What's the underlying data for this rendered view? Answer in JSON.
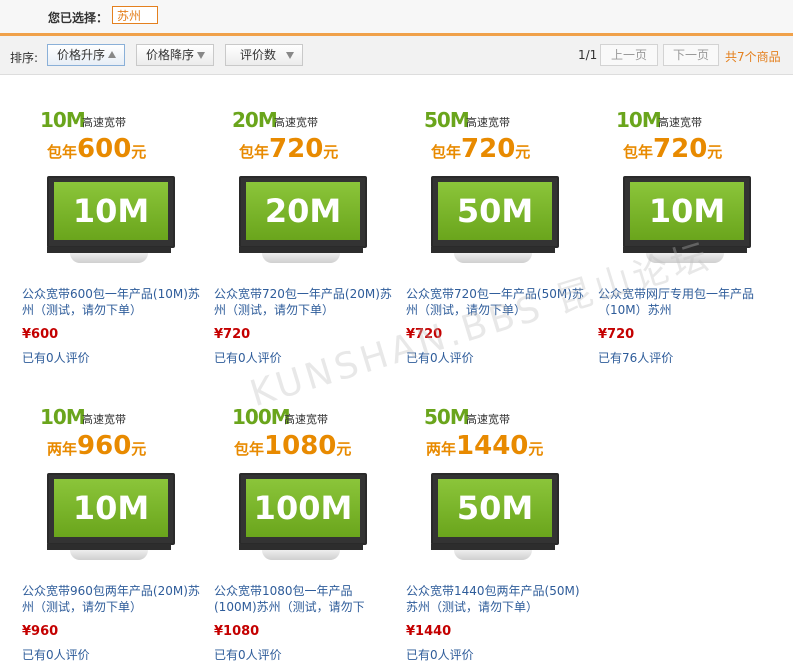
{
  "selected": {
    "label": "您已选择：",
    "value": "苏州"
  },
  "sort": {
    "label": "排序:",
    "buttons": [
      "价格升序",
      "价格降序",
      "评价数"
    ]
  },
  "pager": {
    "page": "1/1",
    "prev": "上一页",
    "next": "下一页",
    "total": "共7个商品"
  },
  "watermark": "KUNSHAN.BBS 昆山论坛",
  "products": [
    {
      "speed": "10M",
      "tag": "高速宽带",
      "price_prefix": "包年",
      "price_num": "600",
      "price_suffix": "元",
      "screen": "10M",
      "title": "公众宽带600包一年产品(10M)苏州（测试，请勿下单）",
      "price": "¥600",
      "reviews": "已有0人评价"
    },
    {
      "speed": "20M",
      "tag": "高速宽带",
      "price_prefix": "包年",
      "price_num": "720",
      "price_suffix": "元",
      "screen": "20M",
      "title": "公众宽带720包一年产品(20M)苏州（测试，请勿下单）",
      "price": "¥720",
      "reviews": "已有0人评价"
    },
    {
      "speed": "50M",
      "tag": "高速宽带",
      "price_prefix": "包年",
      "price_num": "720",
      "price_suffix": "元",
      "screen": "50M",
      "title": "公众宽带720包一年产品(50M)苏州（测试，请勿下单）",
      "price": "¥720",
      "reviews": "已有0人评价"
    },
    {
      "speed": "10M",
      "tag": "高速宽带",
      "price_prefix": "包年",
      "price_num": "720",
      "price_suffix": "元",
      "screen": "10M",
      "title": "公众宽带网厅专用包一年产品（10M）苏州",
      "price": "¥720",
      "reviews": "已有76人评价"
    },
    {
      "speed": "10M",
      "tag": "高速宽带",
      "price_prefix": "两年",
      "price_num": "960",
      "price_suffix": "元",
      "screen": "10M",
      "title": "公众宽带960包两年产品(20M)苏州（测试，请勿下单）",
      "price": "¥960",
      "reviews": "已有0人评价"
    },
    {
      "speed": "100M",
      "tag": "高速宽带",
      "price_prefix": "包年",
      "price_num": "1080",
      "price_suffix": "元",
      "screen": "100M",
      "title": "公众宽带1080包一年产品(100M)苏州（测试，请勿下",
      "price": "¥1080",
      "reviews": "已有0人评价"
    },
    {
      "speed": "50M",
      "tag": "高速宽带",
      "price_prefix": "两年",
      "price_num": "1440",
      "price_suffix": "元",
      "screen": "50M",
      "title": "公众宽带1440包两年产品(50M)苏州（测试，请勿下单）",
      "price": "¥1440",
      "reviews": "已有0人评价"
    }
  ]
}
